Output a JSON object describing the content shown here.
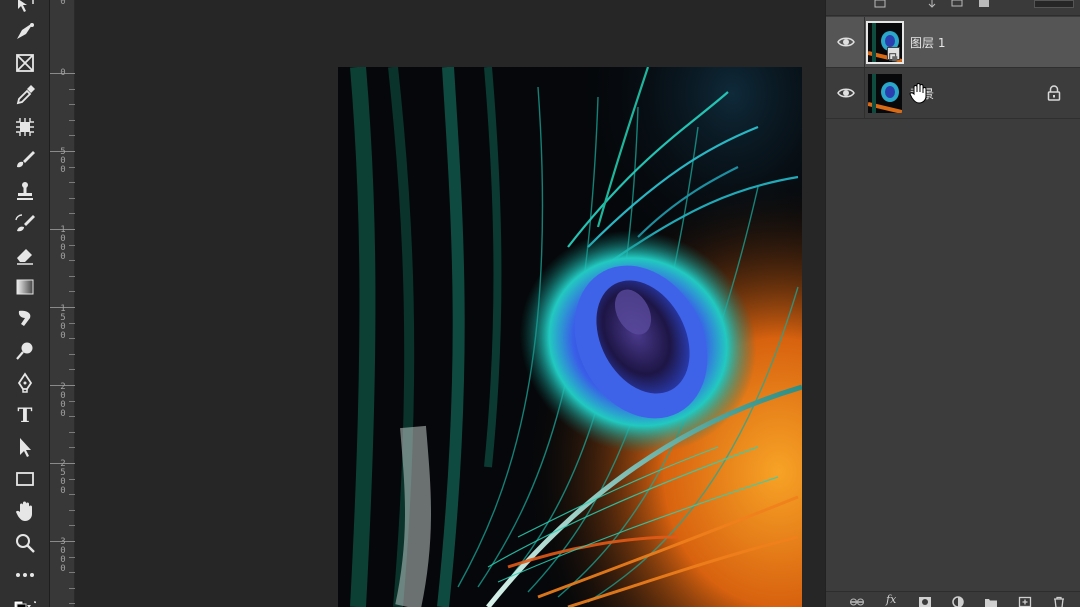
{
  "ruler": {
    "labels": [
      "0",
      "0",
      "500",
      "1000",
      "1500",
      "2000",
      "2500",
      "3000"
    ]
  },
  "layers": [
    {
      "name": "图层 1",
      "visible": true,
      "selected": true,
      "smart_object": true,
      "locked": false
    },
    {
      "name": "背景",
      "visible": true,
      "selected": false,
      "smart_object": false,
      "locked": true
    }
  ],
  "toolbar": {
    "tools": [
      "move-tool-icon",
      "pen-nib-icon",
      "frame-tool-icon",
      "eyedropper-icon",
      "crop-object-icon",
      "brush-icon",
      "clone-stamp-icon",
      "history-brush-icon",
      "eraser-icon",
      "gradient-icon",
      "smudge-icon",
      "dodge-icon",
      "pen-tool-icon",
      "type-tool-icon",
      "path-selection-icon",
      "rectangle-tool-icon",
      "hand-tool-icon",
      "zoom-tool-icon",
      "more-tools-icon",
      "swap-colors-icon"
    ]
  },
  "panel_bottom": {
    "fx_label": "fx"
  },
  "colors": {
    "accent_teal": "#1fc7b0",
    "peacock_blue": "#2f55d6",
    "feather_orange": "#f08a1c"
  }
}
